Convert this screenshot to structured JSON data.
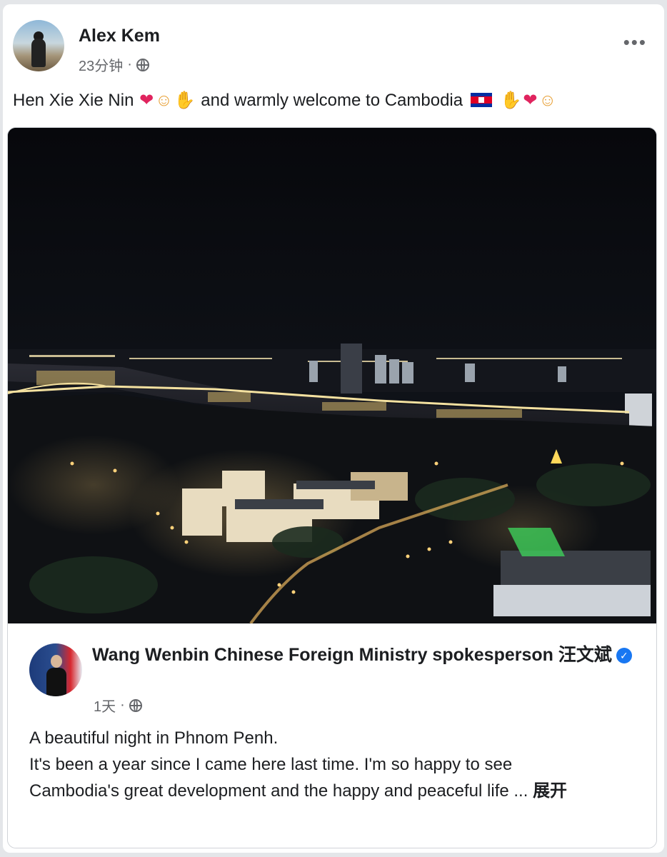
{
  "post": {
    "author": "Alex Kem",
    "time": "23分钟",
    "separator": "·",
    "more_label": "•••",
    "text_start": "Hen Xie Xie Nin",
    "text_middle": "and warmly welcome to Cambodia",
    "emoji_icons": [
      "heart-eyes-icon",
      "hug-face-icon",
      "praying-hands-icon",
      "cambodia-flag-icon"
    ]
  },
  "shared": {
    "author": "Wang Wenbin Chinese Foreign Ministry spokesperson 汪文斌",
    "time": "1天",
    "separator": "·",
    "line1": "A beautiful night in Phnom Penh.",
    "line2": "It's been a year since I came here last time. I'm so happy to see",
    "line3": "Cambodia's great development and the happy and peaceful life ...",
    "expand_label": "展开",
    "photo_alt": "Night aerial view of Phnom Penh city lights along the river"
  },
  "colors": {
    "accent_blue": "#1877f2",
    "meta_gray": "#65676b",
    "text": "#1c1e21"
  }
}
